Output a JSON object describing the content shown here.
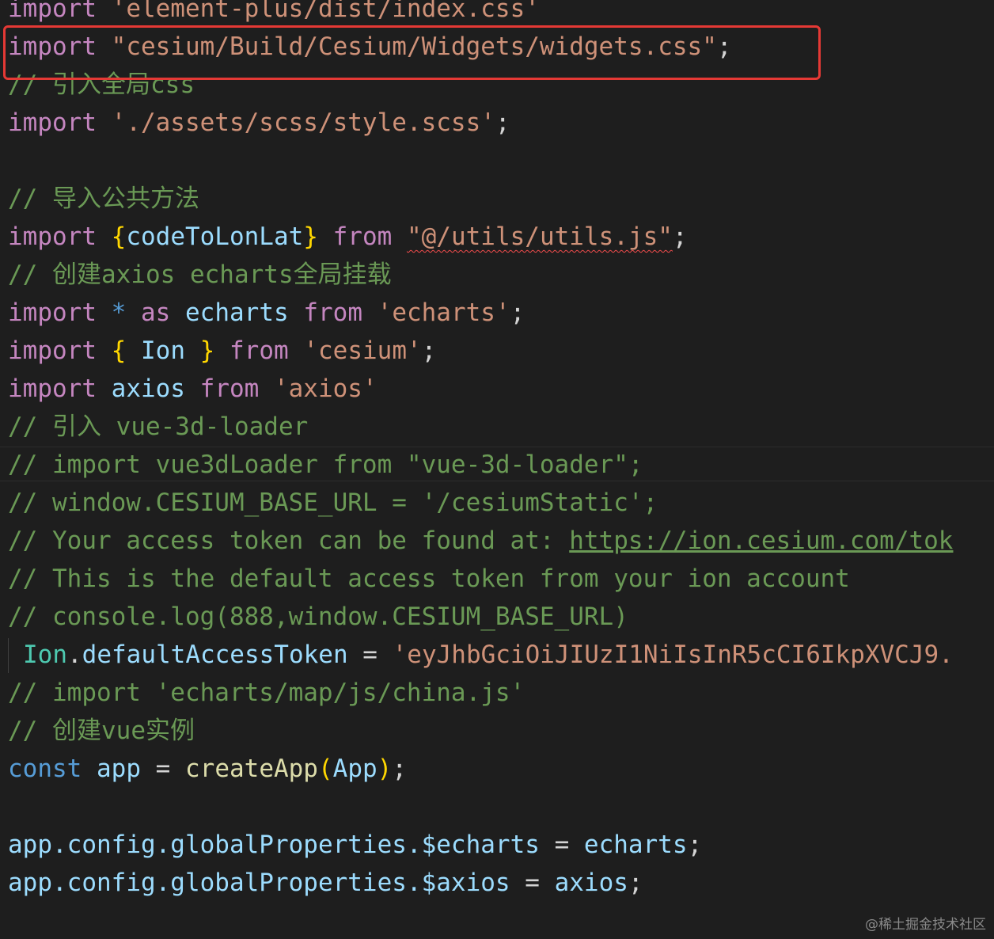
{
  "code": {
    "l0": {
      "kw": "import",
      "str": "'element-plus/dist/index.css'"
    },
    "l1": {
      "kw": "import",
      "str": "\"cesium/Build/Cesium/Widgets/widgets.css\"",
      "semi": ";"
    },
    "l2": {
      "cmt": "// 引入全局css"
    },
    "l3": {
      "kw": "import",
      "str": "'./assets/scss/style.scss'",
      "semi": ";"
    },
    "l5": {
      "cmt": "// 导入公共方法"
    },
    "l6": {
      "kw": "import",
      "open": "{",
      "name": "codeToLonLat",
      "close": "}",
      "from": "from",
      "str": "\"@/utils/utils.js\"",
      "semi": ";"
    },
    "l7": {
      "cmt": "// 创建axios echarts全局挂载"
    },
    "l8": {
      "kw": "import",
      "star": "*",
      "as": "as",
      "name": "echarts",
      "from": "from",
      "str": "'echarts'",
      "semi": ";"
    },
    "l9": {
      "kw": "import",
      "open": "{",
      "name": "Ion",
      "close": "}",
      "from": "from",
      "str": "'cesium'",
      "semi": ";"
    },
    "l10": {
      "kw": "import",
      "name": "axios",
      "from": "from",
      "str": "'axios'"
    },
    "l11": {
      "cmt": "// 引入 vue-3d-loader"
    },
    "l12": {
      "cmt": "// import vue3dLoader from \"vue-3d-loader\";"
    },
    "l13": {
      "cmt": "// window.CESIUM_BASE_URL = '/cesiumStatic';"
    },
    "l14": {
      "cmt": "// Your access token can be found at: ",
      "url": "https://ion.cesium.com/tok"
    },
    "l15": {
      "cmt": "// This is the default access token from your ion account"
    },
    "l16": {
      "cmt": "// console.log(888,window.CESIUM_BASE_URL)"
    },
    "l17": {
      "obj": "Ion",
      "dot": ".",
      "prop": "defaultAccessToken",
      "eq": " = ",
      "str": "'eyJhbGciOiJIUzI1NiIsInR5cCI6IkpXVCJ9."
    },
    "l18": {
      "cmt": "// import 'echarts/map/js/china.js'"
    },
    "l19": {
      "cmt": "// 创建vue实例"
    },
    "l20": {
      "kw": "const",
      "name": "app",
      "eq": " = ",
      "fn": "createApp",
      "open": "(",
      "arg": "App",
      "close": ")",
      "semi": ";"
    },
    "l22": {
      "obj": "app",
      "rest": ".config.globalProperties.$echarts",
      "eq": " = ",
      "val": "echarts",
      "semi": ";"
    },
    "l23": {
      "obj": "app",
      "rest": ".config.globalProperties.$axios",
      "eq": " = ",
      "val": "axios",
      "semi": ";"
    }
  },
  "watermark": "@稀土掘金技术社区",
  "colors": {
    "background": "#1e1e1e",
    "keyword": "#c586c0",
    "variable": "#9cdcfe",
    "string": "#ce9178",
    "comment": "#6a9955",
    "bracket": "#ffd700",
    "highlight_box": "#e53935"
  }
}
